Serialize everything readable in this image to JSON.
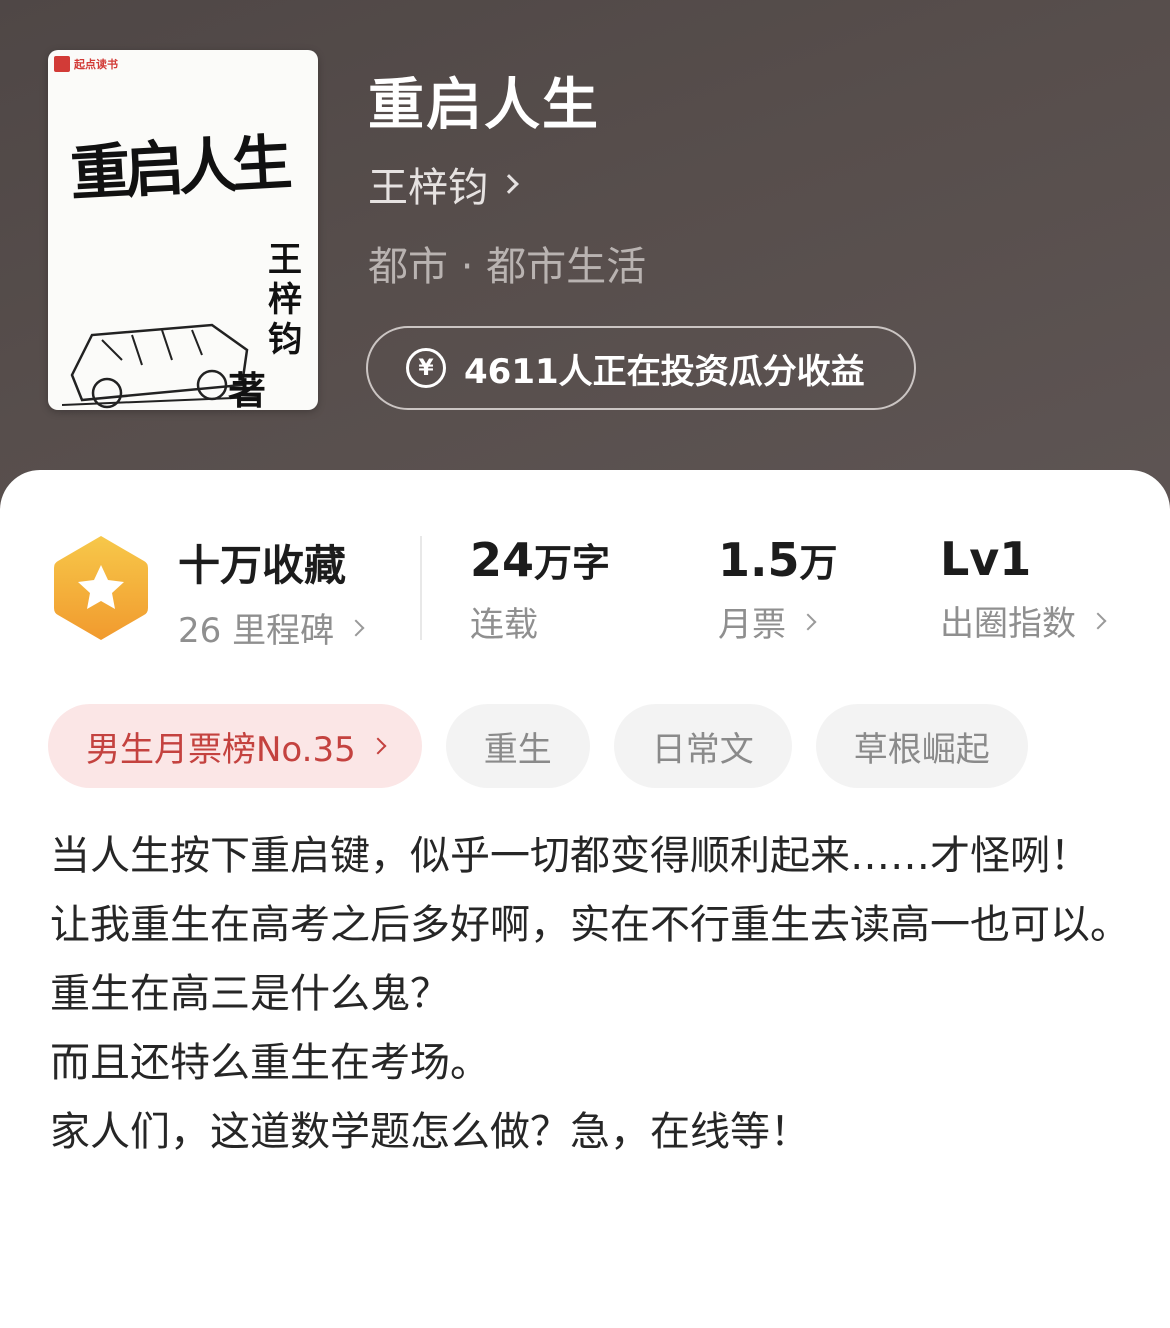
{
  "book": {
    "title": "重启人生",
    "author": "王梓钧",
    "genre": "都市 · 都市生活",
    "invest_text": "4611人正在投资瓜分收益",
    "invest_icon": "yen-circle-icon"
  },
  "cover": {
    "brand": "起点读书",
    "title": "重启人生",
    "author": "王梓钧",
    "suffix": "著"
  },
  "stats": [
    {
      "value": "十万收藏",
      "sub": "26 里程碑"
    },
    {
      "value_num": "24",
      "value_unit": "万字",
      "sub": "连载"
    },
    {
      "value_num": "1.5",
      "value_unit": "万",
      "sub": "月票"
    },
    {
      "value": "Lv1",
      "sub": "出圈指数"
    }
  ],
  "tags": [
    {
      "label": "男生月票榜No.35"
    },
    {
      "label": "重生"
    },
    {
      "label": "日常文"
    },
    {
      "label": "草根崛起"
    }
  ],
  "synopsis": [
    "当人生按下重启键，似乎一切都变得顺利起来……才怪咧！",
    "让我重生在高考之后多好啊，实在不行重生去读高一也可以。",
    "重生在高三是什么鬼？",
    "而且还特么重生在考场。",
    "家人们，这道数学题怎么做？急，在线等！"
  ],
  "colors": {
    "hero_bg": "#574e4c",
    "badge_gold": "#f4b33c",
    "rank_red": "#c4423f",
    "rank_bg": "#fbe6e6"
  }
}
